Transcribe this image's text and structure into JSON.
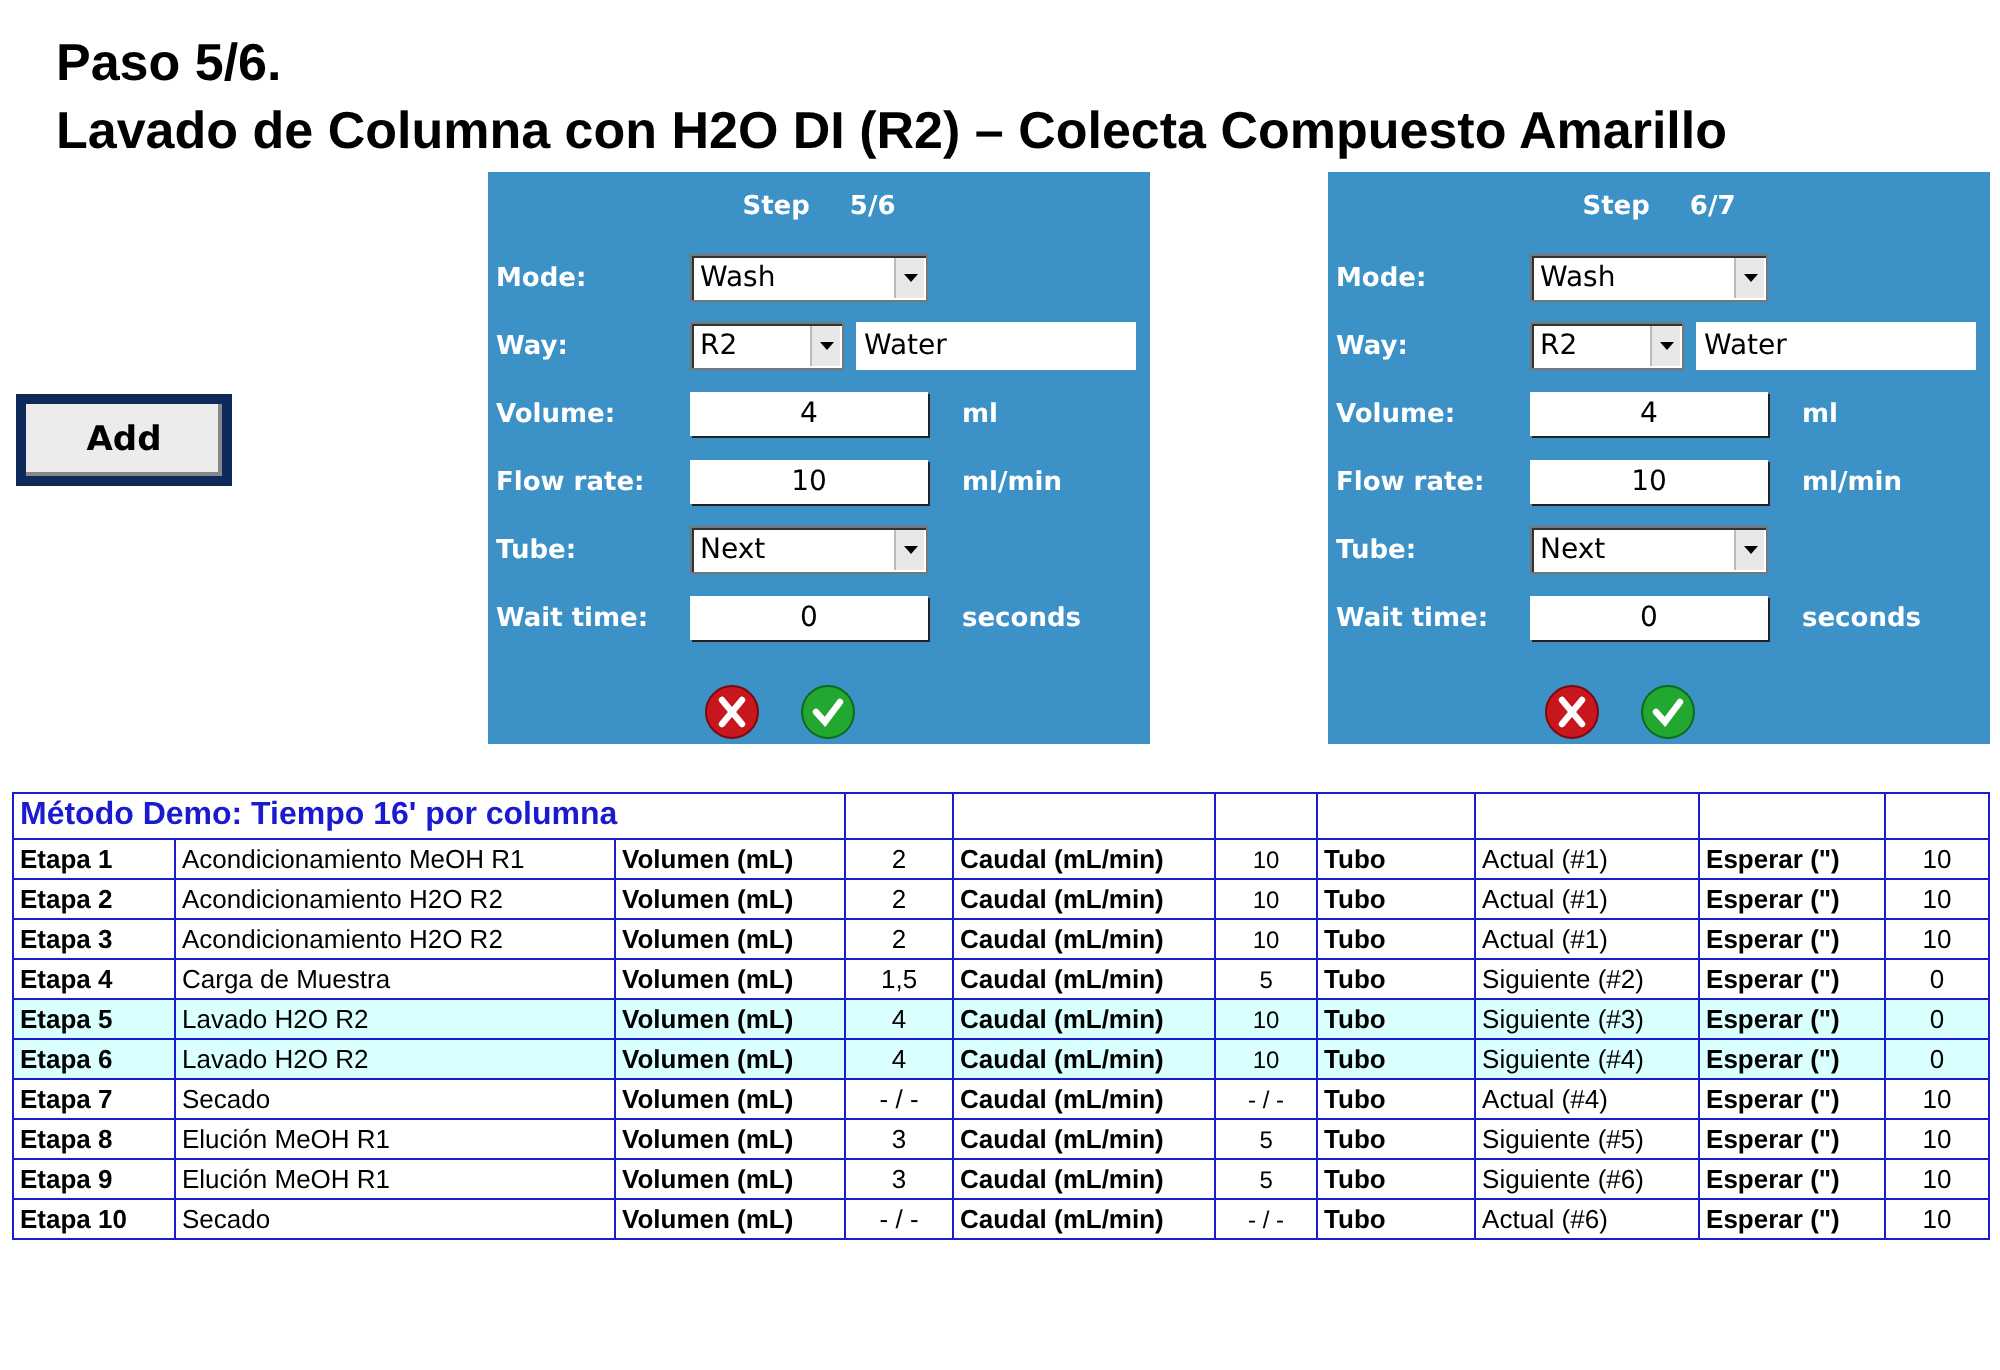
{
  "title_lines": [
    "Paso 5/6.",
    "Lavado de Columna con H2O DI (R2) – Colecta Compuesto Amarillo"
  ],
  "add_button": "Add",
  "dialogs": [
    {
      "title": "Step",
      "step": "5/6",
      "fields": [
        {
          "kind": "select",
          "label": "Mode:",
          "value": "Wash"
        },
        {
          "kind": "way",
          "label": "Way:",
          "value": "R2",
          "name": "Water"
        },
        {
          "kind": "number",
          "label": "Volume:",
          "value": "4",
          "unit": "ml"
        },
        {
          "kind": "number",
          "label": "Flow rate:",
          "value": "10",
          "unit": "ml/min"
        },
        {
          "kind": "select",
          "label": "Tube:",
          "value": "Next"
        },
        {
          "kind": "number",
          "label": "Wait time:",
          "value": "0",
          "unit": "seconds"
        }
      ]
    },
    {
      "title": "Step",
      "step": "6/7",
      "fields": [
        {
          "kind": "select",
          "label": "Mode:",
          "value": "Wash"
        },
        {
          "kind": "way",
          "label": "Way:",
          "value": "R2",
          "name": "Water"
        },
        {
          "kind": "number",
          "label": "Volume:",
          "value": "4",
          "unit": "ml"
        },
        {
          "kind": "number",
          "label": "Flow rate:",
          "value": "10",
          "unit": "ml/min"
        },
        {
          "kind": "select",
          "label": "Tube:",
          "value": "Next"
        },
        {
          "kind": "number",
          "label": "Wait time:",
          "value": "0",
          "unit": "seconds"
        }
      ]
    }
  ],
  "table": {
    "title": "Método Demo: Tiempo 16' por columna",
    "rows": [
      {
        "step": "Etapa 1",
        "description": "Acondicionamiento MeOH R1",
        "volume_label": "Volumen (mL)",
        "volume": "2",
        "flow_label": "Caudal (mL/min)",
        "flow": "10",
        "tube_label": "Tubo",
        "tube": "Actual (#1)",
        "wait_label": "Esperar (\")",
        "wait": "10",
        "selected": false
      },
      {
        "step": "Etapa 2",
        "description": "Acondicionamiento H2O R2",
        "volume_label": "Volumen (mL)",
        "volume": "2",
        "flow_label": "Caudal (mL/min)",
        "flow": "10",
        "tube_label": "Tubo",
        "tube": "Actual (#1)",
        "wait_label": "Esperar (\")",
        "wait": "10",
        "selected": false
      },
      {
        "step": "Etapa 3",
        "description": "Acondicionamiento H2O R2",
        "volume_label": "Volumen (mL)",
        "volume": "2",
        "flow_label": "Caudal (mL/min)",
        "flow": "10",
        "tube_label": "Tubo",
        "tube": "Actual (#1)",
        "wait_label": "Esperar (\")",
        "wait": "10",
        "selected": false
      },
      {
        "step": "Etapa 4",
        "description": "Carga de Muestra",
        "volume_label": "Volumen (mL)",
        "volume": "1,5",
        "flow_label": "Caudal (mL/min)",
        "flow": "5",
        "tube_label": "Tubo",
        "tube": "Siguiente (#2)",
        "wait_label": "Esperar (\")",
        "wait": "0",
        "selected": false
      },
      {
        "step": "Etapa 5",
        "description": "Lavado H2O R2",
        "volume_label": "Volumen (mL)",
        "volume": "4",
        "flow_label": "Caudal (mL/min)",
        "flow": "10",
        "tube_label": "Tubo",
        "tube": "Siguiente (#3)",
        "wait_label": "Esperar (\")",
        "wait": "0",
        "selected": true
      },
      {
        "step": "Etapa 6",
        "description": "Lavado H2O R2",
        "volume_label": "Volumen (mL)",
        "volume": "4",
        "flow_label": "Caudal (mL/min)",
        "flow": "10",
        "tube_label": "Tubo",
        "tube": "Siguiente (#4)",
        "wait_label": "Esperar (\")",
        "wait": "0",
        "selected": true
      },
      {
        "step": "Etapa 7",
        "description": "Secado",
        "volume_label": "Volumen (mL)",
        "volume": "- / -",
        "flow_label": "Caudal (mL/min)",
        "flow": "- / -",
        "tube_label": "Tubo",
        "tube": "Actual (#4)",
        "wait_label": "Esperar (\")",
        "wait": "10",
        "selected": false
      },
      {
        "step": "Etapa 8",
        "description": "Elución MeOH R1",
        "volume_label": "Volumen (mL)",
        "volume": "3",
        "flow_label": "Caudal (mL/min)",
        "flow": "5",
        "tube_label": "Tubo",
        "tube": "Siguiente (#5)",
        "wait_label": "Esperar (\")",
        "wait": "10",
        "selected": false
      },
      {
        "step": "Etapa 9",
        "description": "Elución MeOH R1",
        "volume_label": "Volumen (mL)",
        "volume": "3",
        "flow_label": "Caudal (mL/min)",
        "flow": "5",
        "tube_label": "Tubo",
        "tube": "Siguiente (#6)",
        "wait_label": "Esperar (\")",
        "wait": "10",
        "selected": false
      },
      {
        "step": "Etapa 10",
        "description": "Secado",
        "volume_label": "Volumen (mL)",
        "volume": "- / -",
        "flow_label": "Caudal (mL/min)",
        "flow": "- / -",
        "tube_label": "Tubo",
        "tube": "Actual (#6)",
        "wait_label": "Esperar (\")",
        "wait": "10",
        "selected": false
      }
    ]
  }
}
